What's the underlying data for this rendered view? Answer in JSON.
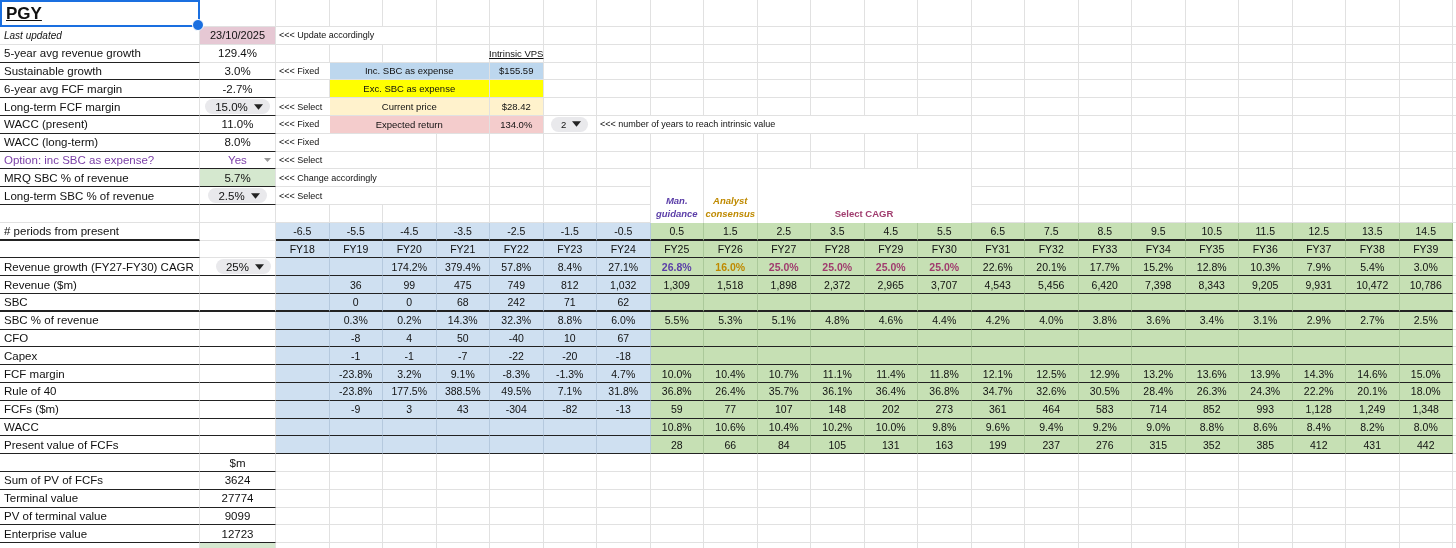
{
  "title": {
    "text": "PGY",
    "selected": true
  },
  "inputs": [
    {
      "label": "Last updated",
      "value": "23/10/2025",
      "kind": "date",
      "note": "<<< Update accordingly"
    },
    {
      "label": "5-year avg revenue growth",
      "value": "129.4%",
      "kind": "text"
    },
    {
      "label": "Sustainable growth",
      "value": "3.0%",
      "kind": "text",
      "note": "<<< Fixed"
    },
    {
      "label": "6-year avg FCF margin",
      "value": "-2.7%",
      "kind": "text"
    },
    {
      "label": "Long-term FCF margin",
      "value": "15.0%",
      "kind": "dropdown",
      "note": "<<< Select"
    },
    {
      "label": "WACC (present)",
      "value": "11.0%",
      "kind": "text",
      "note": "<<< Fixed"
    },
    {
      "label": "WACC (long-term)",
      "value": "8.0%",
      "kind": "text",
      "note": "<<< Fixed"
    },
    {
      "label": "Option: inc SBC as expense?",
      "value": "Yes",
      "kind": "option",
      "note": "<<< Select"
    },
    {
      "label": "MRQ SBC % of revenue",
      "value": "5.7%",
      "kind": "highlight",
      "note": "<<< Change accordingly"
    },
    {
      "label": "Long-term SBC % of revenue",
      "value": "2.5%",
      "kind": "dropdown",
      "note": "<<< Select"
    }
  ],
  "valuation": {
    "header": "Intrinsic VPS",
    "items": [
      {
        "label": "Inc. SBC as expense",
        "value": "$155.59",
        "color": "#bdd7ee"
      },
      {
        "label": "Exc. SBC as expense",
        "color": "#ffff00"
      },
      {
        "label": "Current price",
        "value": "$28.42",
        "color": "#fff2cc"
      },
      {
        "label": "Expected return",
        "value": "134.0%",
        "color": "#f4cccc"
      }
    ]
  },
  "years_selector": {
    "value": "2",
    "note": "<<< number of years to reach intrinsic value"
  },
  "column_notes": [
    {
      "text": "Man. guidance",
      "color": "#5b3ea8"
    },
    {
      "text": "Analyst consensus",
      "color": "#bf8a00"
    },
    {
      "text": "Select CAGR",
      "color": "#a03c6e"
    }
  ],
  "table": {
    "periods_label": "# periods from present",
    "columns": [
      {
        "period": "-6.5",
        "year": "FY18",
        "projected": false
      },
      {
        "period": "-5.5",
        "year": "FY19",
        "projected": false
      },
      {
        "period": "-4.5",
        "year": "FY20",
        "projected": false
      },
      {
        "period": "-3.5",
        "year": "FY21",
        "projected": false
      },
      {
        "period": "-2.5",
        "year": "FY22",
        "projected": false
      },
      {
        "period": "-1.5",
        "year": "FY23",
        "projected": false
      },
      {
        "period": "-0.5",
        "year": "FY24",
        "projected": false
      },
      {
        "period": "0.5",
        "year": "FY25",
        "projected": true
      },
      {
        "period": "1.5",
        "year": "FY26",
        "projected": true
      },
      {
        "period": "2.5",
        "year": "FY27",
        "projected": true
      },
      {
        "period": "3.5",
        "year": "FY28",
        "projected": true
      },
      {
        "period": "4.5",
        "year": "FY29",
        "projected": true
      },
      {
        "period": "5.5",
        "year": "FY30",
        "projected": true
      },
      {
        "period": "6.5",
        "year": "FY31",
        "projected": true
      },
      {
        "period": "7.5",
        "year": "FY32",
        "projected": true
      },
      {
        "period": "8.5",
        "year": "FY33",
        "projected": true
      },
      {
        "period": "9.5",
        "year": "FY34",
        "projected": true
      },
      {
        "period": "10.5",
        "year": "FY35",
        "projected": true
      },
      {
        "period": "11.5",
        "year": "FY36",
        "projected": true
      },
      {
        "period": "12.5",
        "year": "FY37",
        "projected": true
      },
      {
        "period": "13.5",
        "year": "FY38",
        "projected": true
      },
      {
        "period": "14.5",
        "year": "FY39",
        "projected": true
      }
    ],
    "rows": [
      {
        "label": "Revenue growth (FY27-FY30) CAGR",
        "control": "25%",
        "cells": [
          null,
          null,
          "174.2%",
          "379.4%",
          "57.8%",
          "8.4%",
          "27.1%",
          {
            "value": "26.8%",
            "color": "#5b3ea8"
          },
          {
            "value": "16.0%",
            "color": "#bf8a00"
          },
          {
            "value": "25.0%",
            "color": "#a03c6e"
          },
          {
            "value": "25.0%",
            "color": "#a03c6e"
          },
          {
            "value": "25.0%",
            "color": "#a03c6e"
          },
          {
            "value": "25.0%",
            "color": "#a03c6e"
          },
          "22.6%",
          "20.1%",
          "17.7%",
          "15.2%",
          "12.8%",
          "10.3%",
          "7.9%",
          "5.4%",
          "3.0%"
        ]
      },
      {
        "label": "Revenue ($m)",
        "cells": [
          null,
          "36",
          "99",
          "475",
          "749",
          "812",
          "1,032",
          "1,309",
          "1,518",
          "1,898",
          "2,372",
          "2,965",
          "3,707",
          "4,543",
          "5,456",
          "6,420",
          "7,398",
          "8,343",
          "9,205",
          "9,931",
          "10,472",
          "10,786"
        ]
      },
      {
        "label": "SBC",
        "cells": [
          null,
          "0",
          "0",
          "68",
          "242",
          "71",
          "62",
          null,
          null,
          null,
          null,
          null,
          null,
          null,
          null,
          null,
          null,
          null,
          null,
          null,
          null,
          null
        ]
      },
      {
        "label": "SBC % of revenue",
        "cells": [
          null,
          "0.3%",
          "0.2%",
          "14.3%",
          "32.3%",
          "8.8%",
          "6.0%",
          "5.5%",
          "5.3%",
          "5.1%",
          "4.8%",
          "4.6%",
          "4.4%",
          "4.2%",
          "4.0%",
          "3.8%",
          "3.6%",
          "3.4%",
          "3.1%",
          "2.9%",
          "2.7%",
          "2.5%"
        ]
      },
      {
        "label": "CFO",
        "cells": [
          null,
          "-8",
          "4",
          "50",
          "-40",
          "10",
          "67",
          null,
          null,
          null,
          null,
          null,
          null,
          null,
          null,
          null,
          null,
          null,
          null,
          null,
          null,
          null
        ]
      },
      {
        "label": "Capex",
        "cells": [
          null,
          "-1",
          "-1",
          "-7",
          "-22",
          "-20",
          "-18",
          null,
          null,
          null,
          null,
          null,
          null,
          null,
          null,
          null,
          null,
          null,
          null,
          null,
          null,
          null
        ]
      },
      {
        "label": "FCF margin",
        "cells": [
          null,
          "-23.8%",
          "3.2%",
          "9.1%",
          "-8.3%",
          "-1.3%",
          "4.7%",
          "10.0%",
          "10.4%",
          "10.7%",
          "11.1%",
          "11.4%",
          "11.8%",
          "12.1%",
          "12.5%",
          "12.9%",
          "13.2%",
          "13.6%",
          "13.9%",
          "14.3%",
          "14.6%",
          "15.0%"
        ]
      },
      {
        "label": "Rule of 40",
        "cells": [
          null,
          "-23.8%",
          "177.5%",
          "388.5%",
          "49.5%",
          "7.1%",
          "31.8%",
          "36.8%",
          "26.4%",
          "35.7%",
          "36.1%",
          "36.4%",
          "36.8%",
          "34.7%",
          "32.6%",
          "30.5%",
          "28.4%",
          "26.3%",
          "24.3%",
          "22.2%",
          "20.1%",
          "18.0%"
        ]
      },
      {
        "label": "FCFs ($m)",
        "cells": [
          null,
          "-9",
          "3",
          "43",
          "-304",
          "-82",
          "-13",
          "59",
          "77",
          "107",
          "148",
          "202",
          "273",
          "361",
          "464",
          "583",
          "714",
          "852",
          "993",
          "1,128",
          "1,249",
          "1,348"
        ]
      },
      {
        "label": "WACC",
        "cells": [
          null,
          null,
          null,
          null,
          null,
          null,
          null,
          "10.8%",
          "10.6%",
          "10.4%",
          "10.2%",
          "10.0%",
          "9.8%",
          "9.6%",
          "9.4%",
          "9.2%",
          "9.0%",
          "8.8%",
          "8.6%",
          "8.4%",
          "8.2%",
          "8.0%"
        ]
      },
      {
        "label": "Present value of FCFs",
        "cells": [
          null,
          null,
          null,
          null,
          null,
          null,
          null,
          "28",
          "66",
          "84",
          "105",
          "131",
          "163",
          "199",
          "237",
          "276",
          "315",
          "352",
          "385",
          "412",
          "431",
          "442"
        ]
      }
    ]
  },
  "summary": {
    "unit": "$m",
    "rows": [
      {
        "label": "Sum of PV of FCFs",
        "value": "3624"
      },
      {
        "label": "Terminal value",
        "value": "27774"
      },
      {
        "label": "PV of terminal value",
        "value": "9099"
      },
      {
        "label": "Enterprise value",
        "value": "12723"
      }
    ]
  }
}
